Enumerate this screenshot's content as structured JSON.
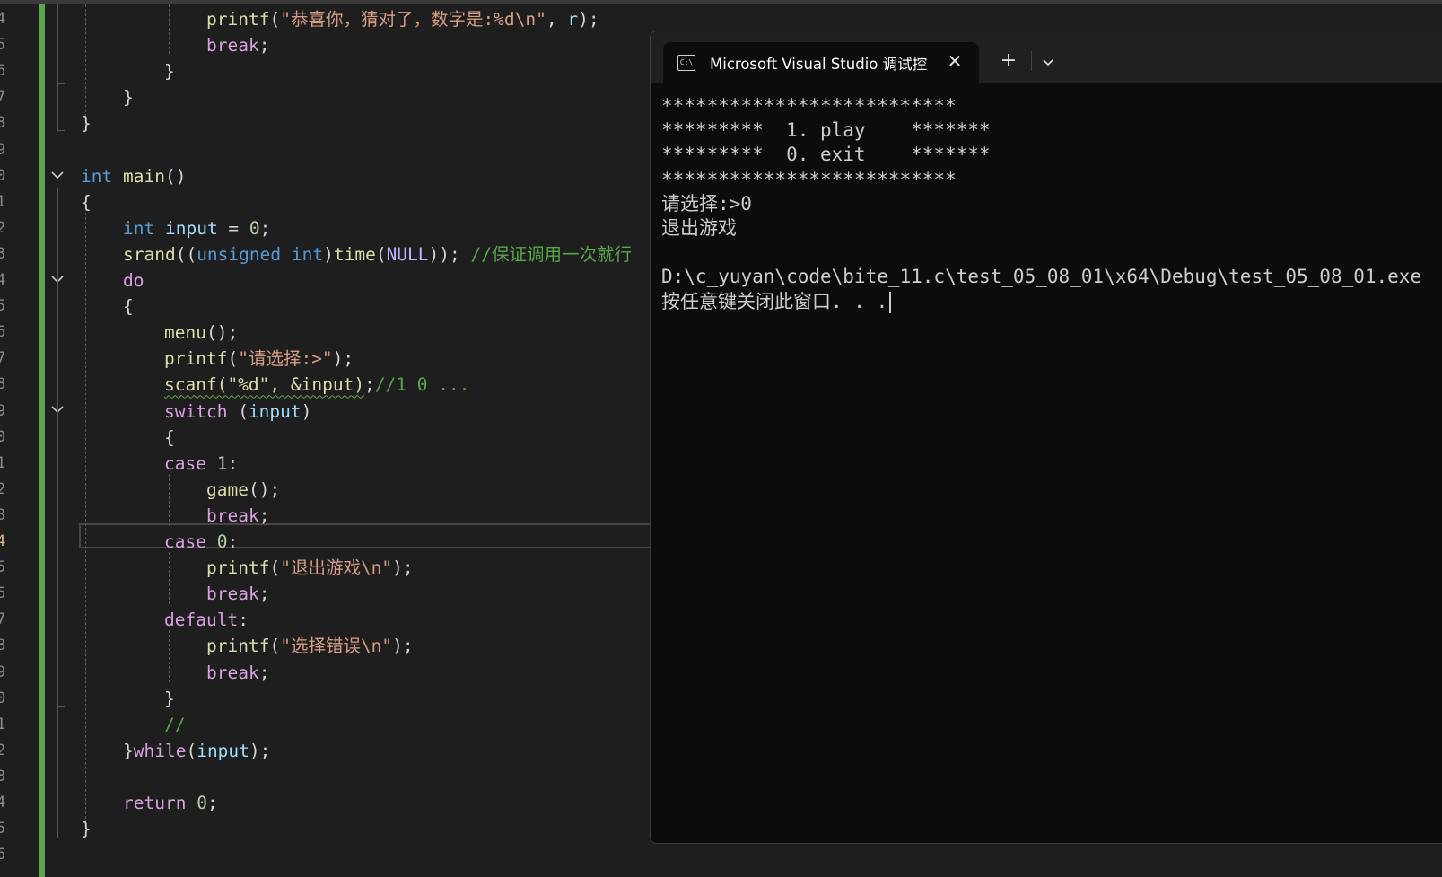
{
  "editor": {
    "line_numbers": [
      "4",
      "5",
      "6",
      "7",
      "8",
      "9",
      "0",
      "1",
      "2",
      "3",
      "4",
      "5",
      "6",
      "7",
      "8",
      "9",
      "0",
      "1",
      "2",
      "3",
      "4",
      "5",
      "6",
      "7",
      "8",
      "9",
      "0",
      "1",
      "2",
      "3",
      "4",
      "5",
      "6"
    ],
    "active_line_number": "4",
    "lines": [
      [
        [
          "fn",
          "printf"
        ],
        [
          "pl",
          "("
        ],
        [
          "str",
          "\"恭喜你，猜对了，数字是:%d\\n\""
        ],
        [
          "pl",
          ", "
        ],
        [
          "var",
          "r"
        ],
        [
          "pl",
          ");"
        ]
      ],
      [
        [
          "ctl",
          "break"
        ],
        [
          "pl",
          ";"
        ]
      ],
      [
        [
          "pl",
          "}"
        ]
      ],
      [
        [
          "pl",
          "}"
        ]
      ],
      [
        [
          "pl",
          "}"
        ]
      ],
      [],
      [
        [
          "kw",
          "int"
        ],
        [
          "pl",
          " "
        ],
        [
          "fn",
          "main"
        ],
        [
          "pl",
          "()"
        ]
      ],
      [
        [
          "pl",
          "{"
        ]
      ],
      [
        [
          "kw",
          "int"
        ],
        [
          "pl",
          " "
        ],
        [
          "var",
          "input"
        ],
        [
          "pl",
          " = "
        ],
        [
          "num",
          "0"
        ],
        [
          "pl",
          ";"
        ]
      ],
      [
        [
          "fn",
          "srand"
        ],
        [
          "pl",
          "(("
        ],
        [
          "kw",
          "unsigned"
        ],
        [
          "pl",
          " "
        ],
        [
          "kw",
          "int"
        ],
        [
          "pl",
          ")"
        ],
        [
          "fn",
          "time"
        ],
        [
          "pl",
          "("
        ],
        [
          "mac",
          "NULL"
        ],
        [
          "pl",
          "));"
        ],
        [
          "pl",
          " "
        ],
        [
          "cm",
          "//保证调用一次就行"
        ]
      ],
      [
        [
          "ctl",
          "do"
        ]
      ],
      [
        [
          "pl",
          "{"
        ]
      ],
      [
        [
          "fn",
          "menu"
        ],
        [
          "pl",
          "();"
        ]
      ],
      [
        [
          "fn",
          "printf"
        ],
        [
          "pl",
          "("
        ],
        [
          "str",
          "\"请选择:>\""
        ],
        [
          "pl",
          ");"
        ]
      ],
      [
        [
          "sq",
          "scanf(\"%d\", &input)"
        ],
        [
          "pl",
          ";"
        ],
        [
          "cm",
          "//1 0 ..."
        ]
      ],
      [
        [
          "ctl",
          "switch"
        ],
        [
          "pl",
          " ("
        ],
        [
          "var",
          "input"
        ],
        [
          "pl",
          ")"
        ]
      ],
      [
        [
          "pl",
          "{"
        ]
      ],
      [
        [
          "ctl",
          "case"
        ],
        [
          "pl",
          " "
        ],
        [
          "num",
          "1"
        ],
        [
          "pl",
          ":"
        ]
      ],
      [
        [
          "fn",
          "game"
        ],
        [
          "pl",
          "();"
        ]
      ],
      [
        [
          "ctl",
          "break"
        ],
        [
          "pl",
          ";"
        ]
      ],
      [
        [
          "ctl",
          "case"
        ],
        [
          "pl",
          " "
        ],
        [
          "num",
          "0"
        ],
        [
          "pl",
          ":"
        ]
      ],
      [
        [
          "fn",
          "printf"
        ],
        [
          "pl",
          "("
        ],
        [
          "str",
          "\"退出游戏\\n\""
        ],
        [
          "pl",
          ");"
        ]
      ],
      [
        [
          "ctl",
          "break"
        ],
        [
          "pl",
          ";"
        ]
      ],
      [
        [
          "ctl",
          "default"
        ],
        [
          "pl",
          ":"
        ]
      ],
      [
        [
          "fn",
          "printf"
        ],
        [
          "pl",
          "("
        ],
        [
          "str",
          "\"选择错误\\n\""
        ],
        [
          "pl",
          ");"
        ]
      ],
      [
        [
          "ctl",
          "break"
        ],
        [
          "pl",
          ";"
        ]
      ],
      [
        [
          "pl",
          "}"
        ]
      ],
      [
        [
          "cm",
          "//"
        ]
      ],
      [
        [
          "pl",
          "}"
        ],
        [
          "ctl",
          "while"
        ],
        [
          "pl",
          "("
        ],
        [
          "var",
          "input"
        ],
        [
          "pl",
          ");"
        ]
      ],
      [],
      [
        [
          "ctl",
          "return"
        ],
        [
          "pl",
          " "
        ],
        [
          "num",
          "0"
        ],
        [
          "pl",
          ";"
        ]
      ],
      [
        [
          "pl",
          "}"
        ]
      ],
      []
    ]
  },
  "terminal": {
    "tab_title": "Microsoft Visual Studio 调试控制台",
    "icon_text": "C:\\",
    "close_glyph": "✕",
    "new_tab_glyph": "+",
    "menu_glyph": "⌄",
    "lines": [
      "**************************",
      "*********  1. play    *******",
      "*********  0. exit    *******",
      "**************************",
      "请选择:>0",
      "退出游戏",
      "",
      "D:\\c_yuyan\\code\\bite_11.c\\test_05_08_01\\x64\\Debug\\test_05_08_01.exe",
      "按任意键关闭此窗口. . ."
    ]
  }
}
